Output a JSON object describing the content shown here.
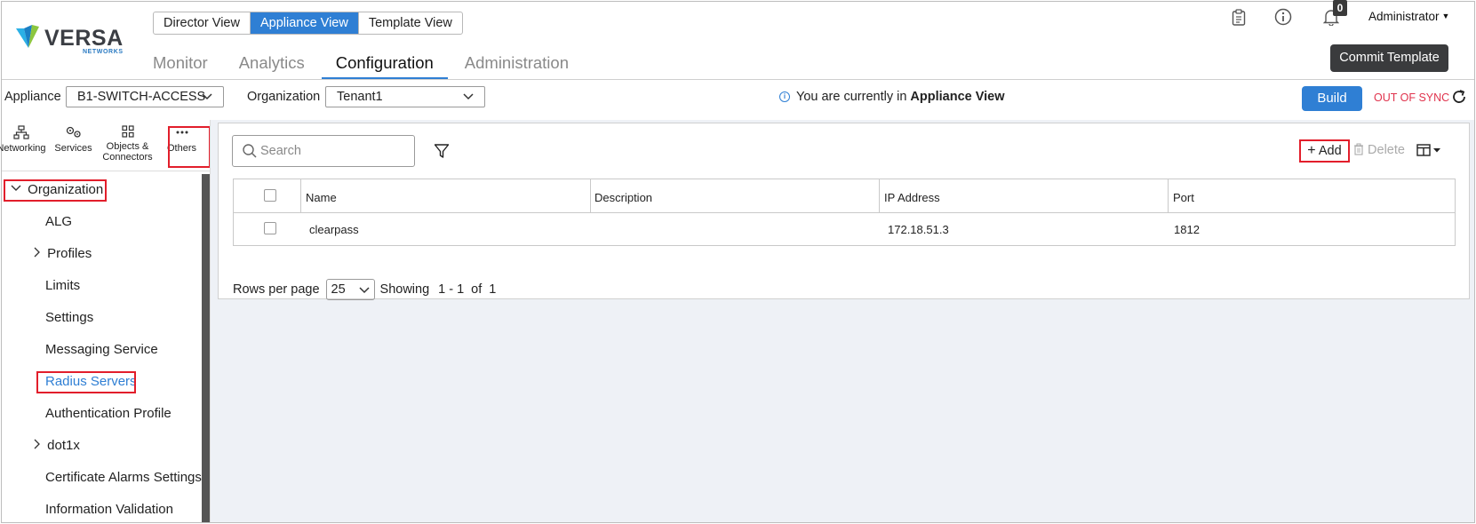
{
  "header": {
    "logo_text": "VERSA",
    "logo_sub": "NETWORKS",
    "views": [
      "Director View",
      "Appliance View",
      "Template View"
    ],
    "active_view": "Appliance View",
    "tabs": [
      "Monitor",
      "Analytics",
      "Configuration",
      "Administration"
    ],
    "active_tab": "Configuration",
    "notification_count": "0",
    "user": "Administrator",
    "commit_label": "Commit Template"
  },
  "toolbar": {
    "appliance_label": "Appliance",
    "appliance_value": "B1-SWITCH-ACCESS",
    "organization_label": "Organization",
    "organization_value": "Tenant1",
    "info_prefix": "You are currently in",
    "info_view": "Appliance View",
    "build_label": "Build",
    "sync_status": "OUT OF SYNC"
  },
  "strip": [
    {
      "label": "Networking",
      "icon": "network-icon"
    },
    {
      "label": "Services",
      "icon": "gears-icon"
    },
    {
      "label": "Objects & Connectors",
      "icon": "objects-icon"
    },
    {
      "label": "Others",
      "icon": "more-icon"
    }
  ],
  "tree": {
    "root": "Organization",
    "items": [
      {
        "label": "ALG",
        "expandable": false
      },
      {
        "label": "Profiles",
        "expandable": true
      },
      {
        "label": "Limits",
        "expandable": false
      },
      {
        "label": "Settings",
        "expandable": false
      },
      {
        "label": "Messaging Service",
        "expandable": false
      },
      {
        "label": "Radius Servers",
        "expandable": false,
        "selected": true
      },
      {
        "label": "Authentication Profile",
        "expandable": false
      },
      {
        "label": "dot1x",
        "expandable": true
      },
      {
        "label": "Certificate Alarms Settings",
        "expandable": false
      },
      {
        "label": "Information Validation",
        "expandable": false
      }
    ]
  },
  "grid": {
    "search_placeholder": "Search",
    "add_label": "Add",
    "delete_label": "Delete",
    "columns": [
      "Name",
      "Description",
      "IP Address",
      "Port"
    ],
    "rows": [
      {
        "name": "clearpass",
        "description": "",
        "ip": "172.18.51.3",
        "port": "1812"
      }
    ],
    "rows_per_page_label": "Rows per page",
    "rows_per_page": "25",
    "showing_label": "Showing",
    "from": "1",
    "to": "1",
    "of_label": "of",
    "total": "1"
  },
  "colors": {
    "accent": "#2f7fd4",
    "highlight": "#e21e2b",
    "out_of_sync": "#e0334d",
    "dark_button": "#3a3b3d"
  }
}
